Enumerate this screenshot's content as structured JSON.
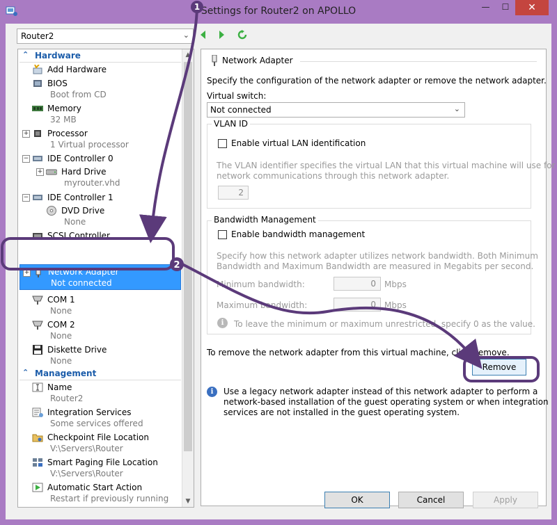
{
  "window": {
    "title": "Settings for Router2 on APOLLO",
    "close_glyph": "✕",
    "minimize_glyph": "—",
    "maximize_glyph": "☐"
  },
  "vm_selector": {
    "value": "Router2"
  },
  "sidebar": {
    "hardware_label": "Hardware",
    "management_label": "Management",
    "hardware_items": [
      {
        "name": "Add Hardware",
        "sub": ""
      },
      {
        "name": "BIOS",
        "sub": "Boot from CD"
      },
      {
        "name": "Memory",
        "sub": "32 MB"
      },
      {
        "name": "Processor",
        "sub": "1 Virtual processor"
      },
      {
        "name": "IDE Controller 0",
        "sub": ""
      },
      {
        "name": "Hard Drive",
        "sub": "myrouter.vhd"
      },
      {
        "name": "IDE Controller 1",
        "sub": ""
      },
      {
        "name": "DVD Drive",
        "sub": "None"
      },
      {
        "name": "SCSI Controller",
        "sub": ""
      },
      {
        "name": "Network Adapter",
        "sub": "Not connected"
      },
      {
        "name": "COM 1",
        "sub": "None"
      },
      {
        "name": "COM 2",
        "sub": "None"
      },
      {
        "name": "Diskette Drive",
        "sub": "None"
      }
    ],
    "management_items": [
      {
        "name": "Name",
        "sub": "Router2"
      },
      {
        "name": "Integration Services",
        "sub": "Some services offered"
      },
      {
        "name": "Checkpoint File Location",
        "sub": "V:\\Servers\\Router"
      },
      {
        "name": "Smart Paging File Location",
        "sub": "V:\\Servers\\Router"
      },
      {
        "name": "Automatic Start Action",
        "sub": "Restart if previously running"
      }
    ]
  },
  "panel": {
    "heading": "Network Adapter",
    "intro": "Specify the configuration of the network adapter or remove the network adapter.",
    "virtual_switch_label": "Virtual switch:",
    "virtual_switch_value": "Not connected",
    "vlan": {
      "group_label": "VLAN ID",
      "checkbox_label": "Enable virtual LAN identification",
      "help_line1": "The VLAN identifier specifies the virtual LAN that this virtual machine will use for all",
      "help_line2": "network communications through this network adapter.",
      "value": "2"
    },
    "bandwidth": {
      "group_label": "Bandwidth Management",
      "checkbox_label": "Enable bandwidth management",
      "help_line1": "Specify how this network adapter utilizes network bandwidth. Both Minimum",
      "help_line2": "Bandwidth and Maximum Bandwidth are measured in Megabits per second.",
      "min_label": "Minimum bandwidth:",
      "min_value": "0",
      "max_label": "Maximum bandwidth:",
      "max_value": "0",
      "unit": "Mbps",
      "note": "To leave the minimum or maximum unrestricted, specify 0 as the value."
    },
    "remove_text": "To remove the network adapter from this virtual machine, click Remove.",
    "remove_button": "Remove",
    "legacy_note_line1": "Use a legacy network adapter instead of this network adapter to perform a",
    "legacy_note_line2": "network-based installation of the guest operating system or when integration",
    "legacy_note_line3": "services are not installed in the guest operating system."
  },
  "footer": {
    "ok": "OK",
    "cancel": "Cancel",
    "apply": "Apply"
  },
  "callouts": {
    "step1": "1",
    "step2": "2"
  },
  "colors": {
    "frame": "#a97bc3",
    "callout": "#5b3a7a",
    "selection": "#3399ff",
    "section_header": "#1c5daa"
  }
}
